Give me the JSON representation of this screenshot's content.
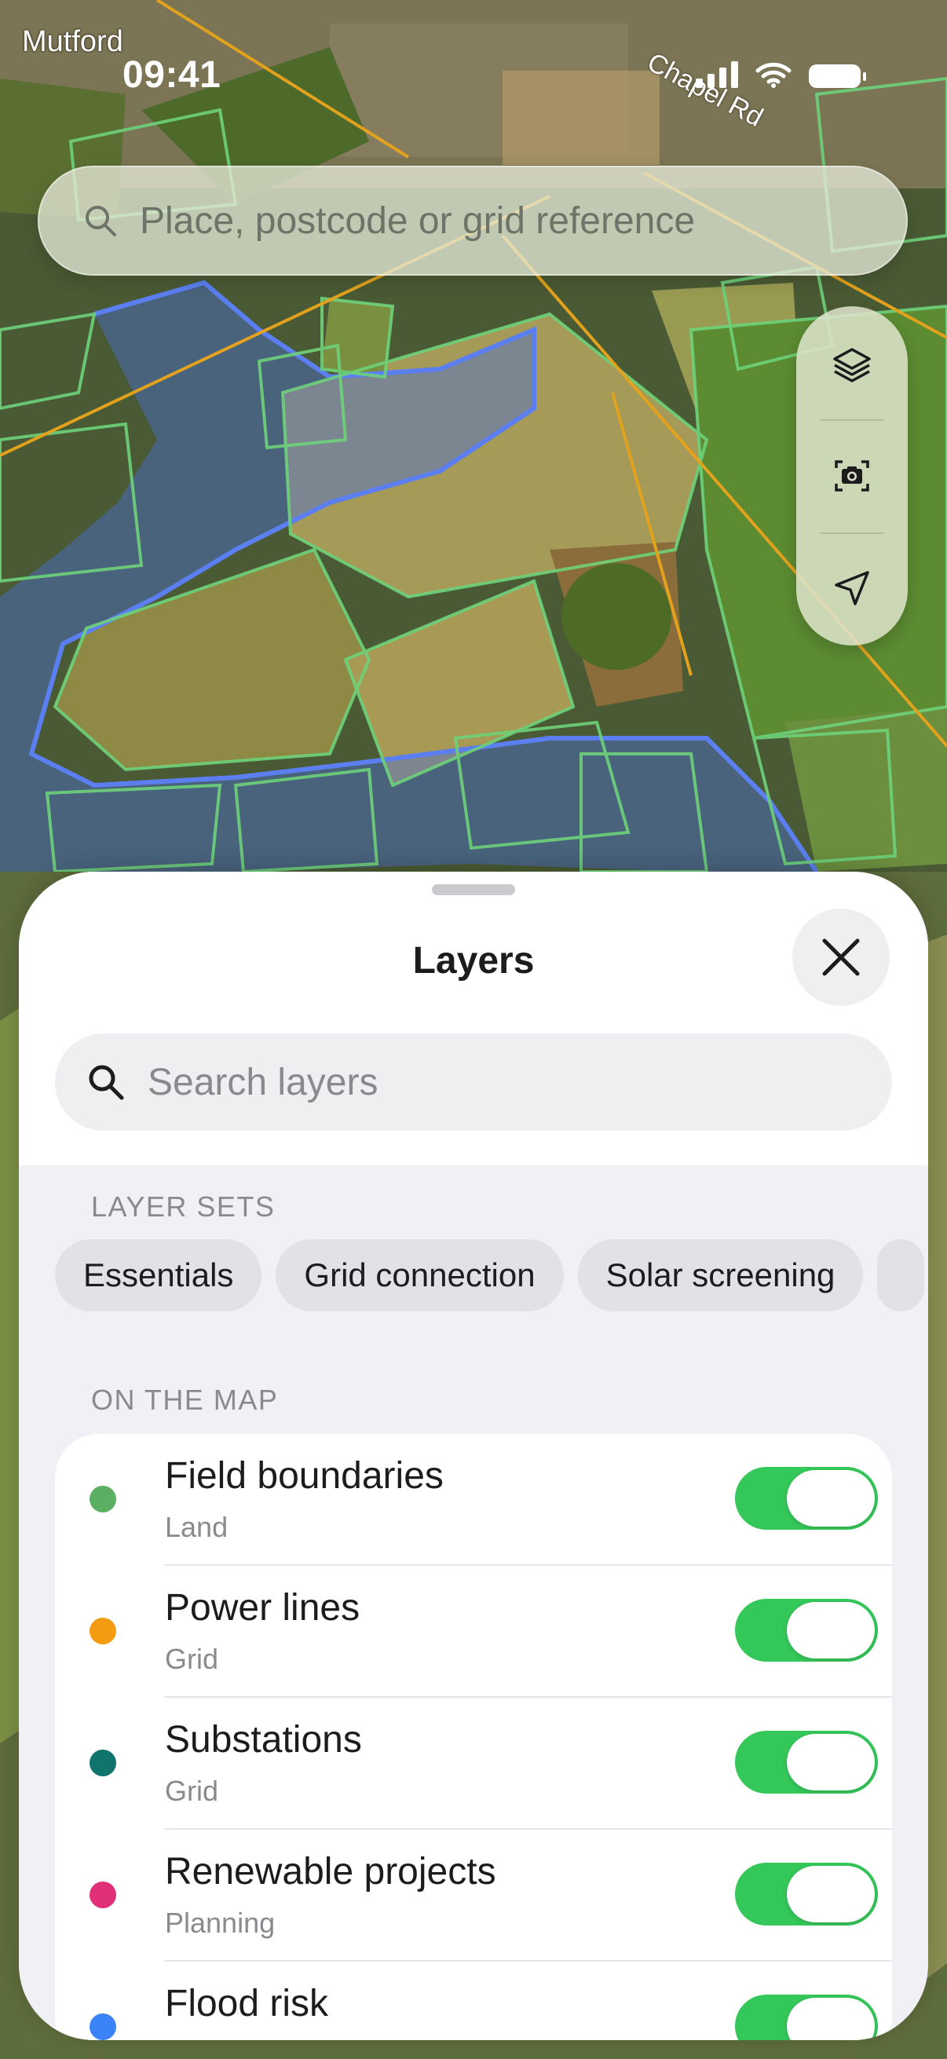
{
  "map": {
    "place_label": "Mutford",
    "road_label": "Chapel Rd",
    "search_placeholder": "Place, postcode or grid reference",
    "controls": [
      {
        "icon": "layers-icon"
      },
      {
        "icon": "screenshot-camera-icon"
      },
      {
        "icon": "location-arrow-icon"
      }
    ]
  },
  "status_bar": {
    "time": "09:41",
    "icons": [
      "cellular-signal-icon",
      "wifi-icon",
      "battery-icon"
    ]
  },
  "sheet": {
    "title": "Layers",
    "close_icon": "close-icon",
    "search_placeholder": "Search layers",
    "layer_sets_label": "LAYER SETS",
    "layer_sets": [
      "Essentials",
      "Grid connection",
      "Solar screening"
    ],
    "on_map_label": "ON THE MAP",
    "layers": [
      {
        "title": "Field boundaries",
        "category": "Land",
        "color": "#5aaf62",
        "enabled": true
      },
      {
        "title": "Power lines",
        "category": "Grid",
        "color": "#f39c12",
        "enabled": true
      },
      {
        "title": "Substations",
        "category": "Grid",
        "color": "#11746c",
        "enabled": true
      },
      {
        "title": "Renewable projects",
        "category": "Planning",
        "color": "#e0307a",
        "enabled": true
      },
      {
        "title": "Flood risk",
        "category": "",
        "color": "#3a82f7",
        "enabled": true
      }
    ]
  },
  "colors": {
    "toggle_on": "#34c759",
    "field_outline": "#6ed27a",
    "power_line": "#e2a21d",
    "flood_zone": "#4a6fd6"
  }
}
